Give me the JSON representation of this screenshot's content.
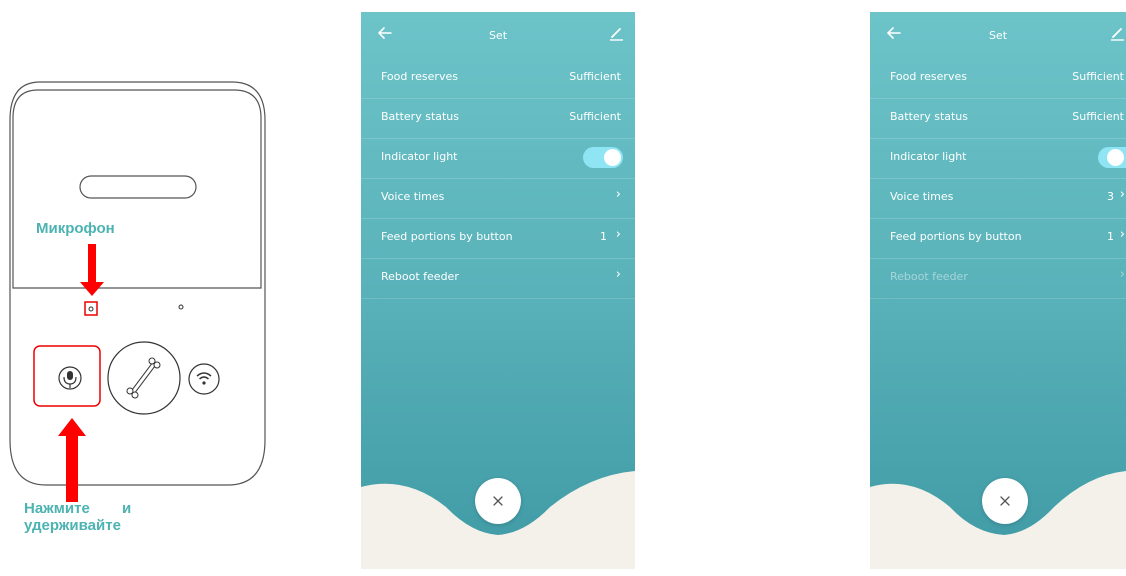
{
  "device": {
    "mic_label": "Микрофон",
    "press_label_line1": "Нажмите и",
    "press_label_line2": "удерживайте"
  },
  "screens": [
    {
      "title": "Set",
      "rows": [
        {
          "label": "Food reserves",
          "value": "Sufficient"
        },
        {
          "label": "Battery status",
          "value": "Sufficient"
        },
        {
          "label": "Indicator light",
          "toggle": "on"
        },
        {
          "label": "Voice times",
          "value": ""
        },
        {
          "label": "Feed portions by button",
          "value": "1"
        },
        {
          "label": "Reboot feeder",
          "value": ""
        }
      ]
    },
    {
      "title": "Set",
      "rows": [
        {
          "label": "Food reserves",
          "value": "Sufficient"
        },
        {
          "label": "Battery status",
          "value": "Sufficient"
        },
        {
          "label": "Indicator light",
          "toggle": "on"
        },
        {
          "label": "Voice times",
          "value": "3"
        },
        {
          "label": "Feed portions by button",
          "value": "1"
        },
        {
          "label": "Reboot feeder",
          "value": "",
          "disabled": true
        }
      ]
    }
  ],
  "colors": {
    "accent_label": "#4bb3b2",
    "arrow_red": "#ff0000",
    "toggle_on": "#8fe5f4",
    "teal_top": "#6cc4c9",
    "teal_bottom": "#3f9aa5"
  },
  "icons": {
    "back": "arrow-left-icon",
    "edit": "pencil-icon",
    "close": "close-x-icon",
    "chevron": "chevron-right-icon",
    "mic": "microphone-icon",
    "feed": "bone-icon",
    "wifi": "wifi-icon"
  }
}
